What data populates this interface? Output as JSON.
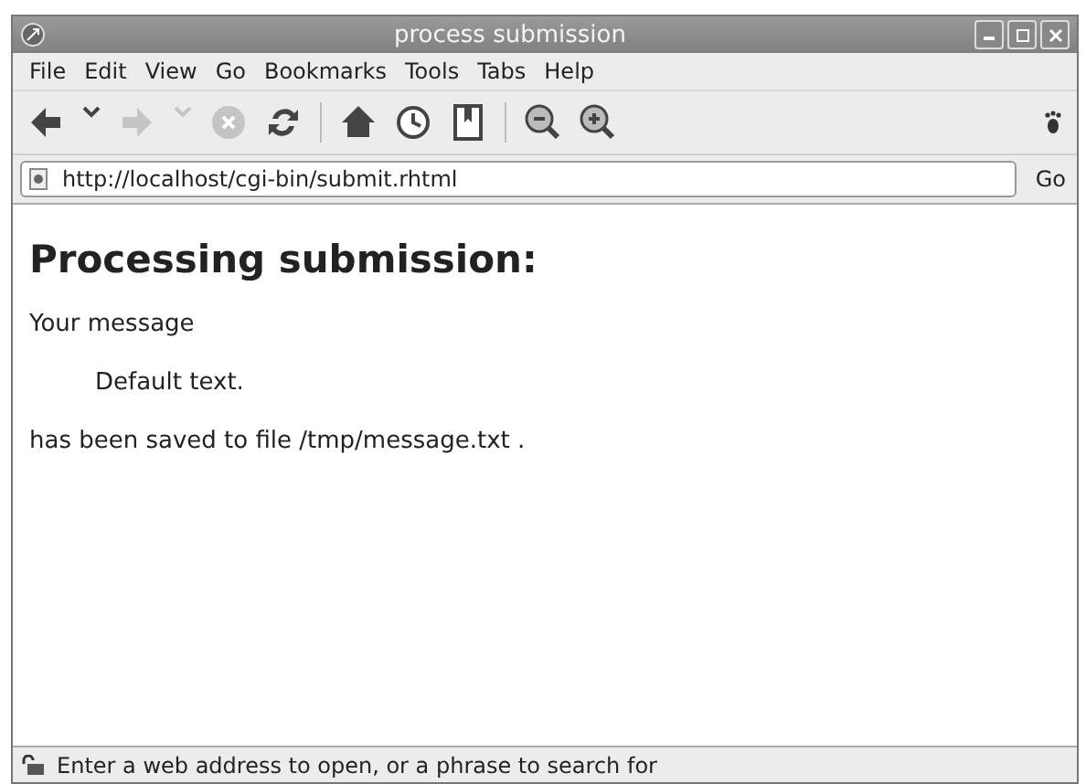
{
  "window": {
    "title": "process submission"
  },
  "menu": [
    "File",
    "Edit",
    "View",
    "Go",
    "Bookmarks",
    "Tools",
    "Tabs",
    "Help"
  ],
  "toolbar": [
    {
      "kind": "back",
      "disabled": false
    },
    {
      "kind": "caret",
      "disabled": false
    },
    {
      "kind": "forward",
      "disabled": true
    },
    {
      "kind": "caret",
      "disabled": true
    },
    {
      "kind": "stop",
      "disabled": true
    },
    {
      "kind": "reload",
      "disabled": false
    },
    {
      "kind": "separator"
    },
    {
      "kind": "home",
      "disabled": false
    },
    {
      "kind": "history",
      "disabled": false
    },
    {
      "kind": "bookmarks",
      "disabled": false
    },
    {
      "kind": "separator"
    },
    {
      "kind": "zoom-out",
      "disabled": false
    },
    {
      "kind": "zoom-in",
      "disabled": false
    }
  ],
  "address": {
    "value": "http://localhost/cgi-bin/submit.rhtml",
    "go": "Go"
  },
  "page": {
    "heading": "Processing submission:",
    "lines": [
      {
        "text": "Your message",
        "indented": false
      },
      {
        "text": "Default text.",
        "indented": true
      },
      {
        "text": "has been saved to file /tmp/message.txt .",
        "indented": false
      }
    ]
  },
  "status_bar": "Enter a web address to open, or a phrase to search for"
}
